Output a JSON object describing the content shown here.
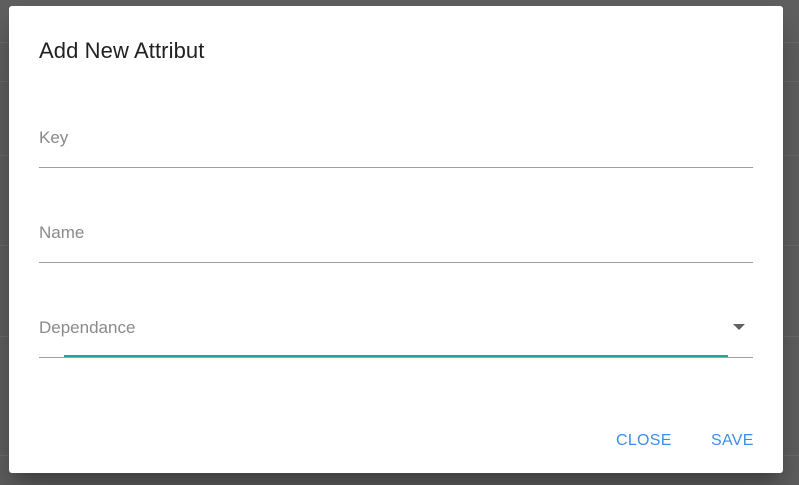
{
  "dialog": {
    "title": "Add New Attribut",
    "fields": {
      "key": {
        "label": "Key",
        "value": ""
      },
      "name": {
        "label": "Name",
        "value": ""
      },
      "dependance": {
        "label": "Dependance",
        "value": "",
        "type": "select"
      }
    },
    "actions": {
      "close_label": "CLOSE",
      "save_label": "SAVE"
    }
  },
  "colors": {
    "accent": "#26a69a",
    "button_text": "#3d8ee8",
    "backdrop": "#5f5f5f"
  },
  "icons": {
    "dropdown": "arrow-drop-down-icon"
  }
}
